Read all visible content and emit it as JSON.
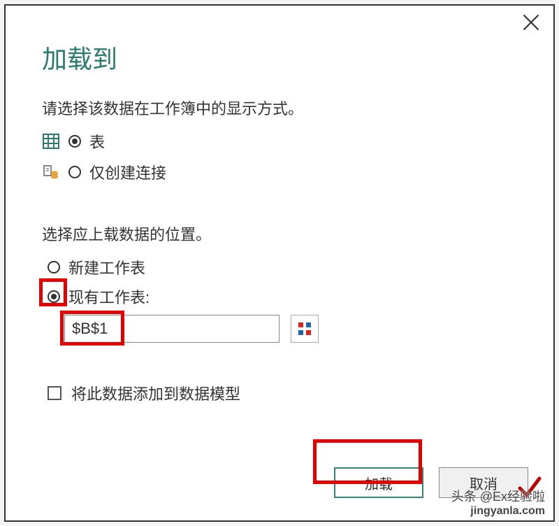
{
  "dialog": {
    "title": "加载到",
    "instruction_display": "请选择该数据在工作簿中的显示方式。",
    "option_table": "表",
    "option_connection_only": "仅创建连接",
    "instruction_location": "选择应上载数据的位置。",
    "option_new_sheet": "新建工作表",
    "option_existing_sheet": "现有工作表:",
    "cell_reference": "$B$1",
    "add_to_data_model": "将此数据添加到数据模型",
    "btn_load": "加载",
    "btn_cancel": "取消"
  },
  "state": {
    "display_selected": "table",
    "location_selected": "existing",
    "data_model_checked": false
  },
  "watermark": {
    "line1": "头条 @Ex经验啦",
    "line2": "jingyanla.com"
  }
}
